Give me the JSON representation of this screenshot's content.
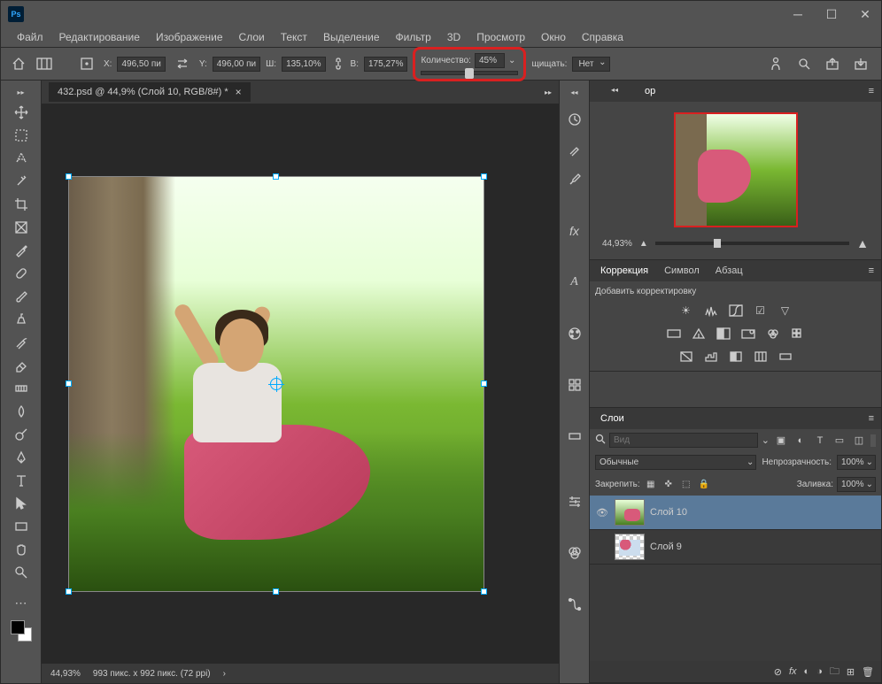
{
  "app": {
    "logo": "Ps"
  },
  "menu": [
    "Файл",
    "Редактирование",
    "Изображение",
    "Слои",
    "Текст",
    "Выделение",
    "Фильтр",
    "3D",
    "Просмотр",
    "Окно",
    "Справка"
  ],
  "options": {
    "x_label": "X:",
    "x_value": "496,50 пи",
    "y_label": "Y:",
    "y_value": "496,00 пи",
    "w_label": "Ш:",
    "w_value": "135,10%",
    "h_label": "В:",
    "h_value": "175,27%",
    "amount_label": "Количество:",
    "amount_value": "45%",
    "protect_label": "щищать:",
    "protect_value": "Нет"
  },
  "tab": {
    "title": "432.psd @ 44,9% (Слой 10, RGB/8#) *"
  },
  "status": {
    "zoom": "44,93%",
    "dims": "993 пикс. x 992 пикс. (72 ppi)"
  },
  "navigator": {
    "title": "ор",
    "zoom": "44,93%"
  },
  "corrections": {
    "tabs": [
      "Коррекция",
      "Символ",
      "Абзац"
    ],
    "label": "Добавить корректировку"
  },
  "layers": {
    "title": "Слои",
    "search_placeholder": "Вид",
    "blend_mode": "Обычные",
    "opacity_label": "Непрозрачность:",
    "opacity_value": "100%",
    "lock_label": "Закрепить:",
    "fill_label": "Заливка:",
    "fill_value": "100%",
    "items": [
      {
        "name": "Слой 10",
        "visible": true
      },
      {
        "name": "Слой 9",
        "visible": false
      }
    ]
  }
}
